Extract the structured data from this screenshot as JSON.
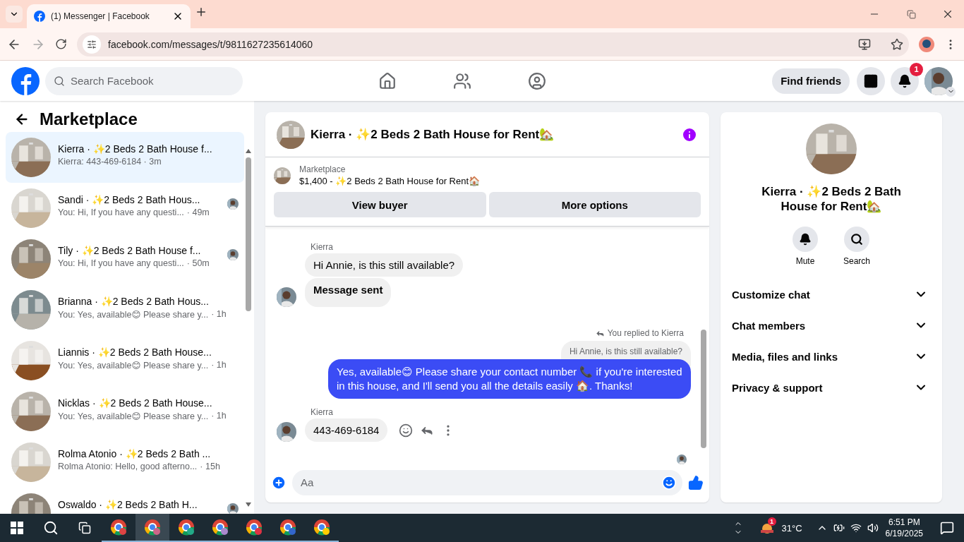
{
  "browser": {
    "tab_title": "(1) Messenger | Facebook",
    "url": "facebook.com/messages/t/9811627235614060"
  },
  "header": {
    "search_placeholder": "Search Facebook",
    "find_friends": "Find friends",
    "notification_count": "1"
  },
  "sidebar": {
    "title": "Marketplace",
    "conversations": [
      {
        "title": "Kierra · ✨2 Beds 2 Bath House f...",
        "preview": "Kierra: 443-469-6184 · 3m",
        "selected": true,
        "unread_receipt": false
      },
      {
        "title": "Sandi · ✨2 Beds 2 Bath Hous...",
        "preview": "You: Hi, If you have any questi...",
        "time": "· 49m",
        "selected": false,
        "unread_receipt": true
      },
      {
        "title": "Tily · ✨2 Beds 2 Bath House f...",
        "preview": "You: Hi, If you have any questi...",
        "time": "· 50m",
        "selected": false,
        "unread_receipt": true
      },
      {
        "title": "Brianna · ✨2 Beds 2 Bath Hous...",
        "preview": "You: Yes, available😊 Please share y...",
        "time": "· 1h",
        "selected": false,
        "unread_receipt": false
      },
      {
        "title": "Liannis · ✨2 Beds 2 Bath House...",
        "preview": "You: Yes, available😊 Please share y...",
        "time": "· 1h",
        "selected": false,
        "unread_receipt": false
      },
      {
        "title": "Nicklas · ✨2 Beds 2 Bath House...",
        "preview": "You: Yes, available😊 Please share y...",
        "time": "· 1h",
        "selected": false,
        "unread_receipt": false
      },
      {
        "title": "Rolma Atonio · ✨2 Beds 2 Bath ...",
        "preview": "Rolma Atonio: Hello, good afterno...",
        "time": "· 15h",
        "selected": false,
        "unread_receipt": false
      },
      {
        "title": "Oswaldo · ✨2 Beds 2 Bath H...",
        "selected": false,
        "unread_receipt": true
      }
    ]
  },
  "chat": {
    "title": "Kierra · ✨2 Beds 2 Bath House for Rent🏡",
    "listing": {
      "label": "Marketplace",
      "summary": "$1,400 - ✨2 Beds 2 Bath House for Rent🏠"
    },
    "buttons": [
      "View buyer",
      "More options"
    ],
    "messages": [
      {
        "kind": "sender",
        "text": "Kierra"
      },
      {
        "kind": "incoming",
        "text": "Hi Annie, is this still available?",
        "avatar": false,
        "bold": false,
        "actions": false
      },
      {
        "kind": "incoming",
        "text": "Message sent",
        "avatar": true,
        "bold": true,
        "actions": false
      },
      {
        "kind": "reply_note",
        "text": "You replied to Kierra"
      },
      {
        "kind": "quoted",
        "text": "Hi Annie, is this still available?"
      },
      {
        "kind": "outgoing",
        "text": "Yes, available😊 Please share your contact number 📞 if you're interested in this house, and I'll send you all the details easily 🏠. Thanks!"
      },
      {
        "kind": "sender",
        "text": "Kierra"
      },
      {
        "kind": "incoming",
        "text": "443-469-6184",
        "avatar": true,
        "bold": false,
        "actions": true
      },
      {
        "kind": "seen"
      }
    ],
    "composer_placeholder": "Aa"
  },
  "details": {
    "title": "Kierra · ✨2 Beds 2 Bath House for Rent🏡",
    "actions": [
      {
        "kind": "mute",
        "label": "Mute"
      },
      {
        "kind": "search",
        "label": "Search"
      }
    ],
    "sections": [
      {
        "label": "Customize chat",
        "expanded": false
      },
      {
        "label": "Chat members",
        "expanded": false
      },
      {
        "label": "Media, files and links",
        "expanded": false
      },
      {
        "label": "Privacy & support",
        "expanded": false
      }
    ]
  },
  "taskbar": {
    "temperature": "31°C",
    "weather_badge": "1",
    "time": "6:51 PM",
    "date": "6/19/2025"
  }
}
